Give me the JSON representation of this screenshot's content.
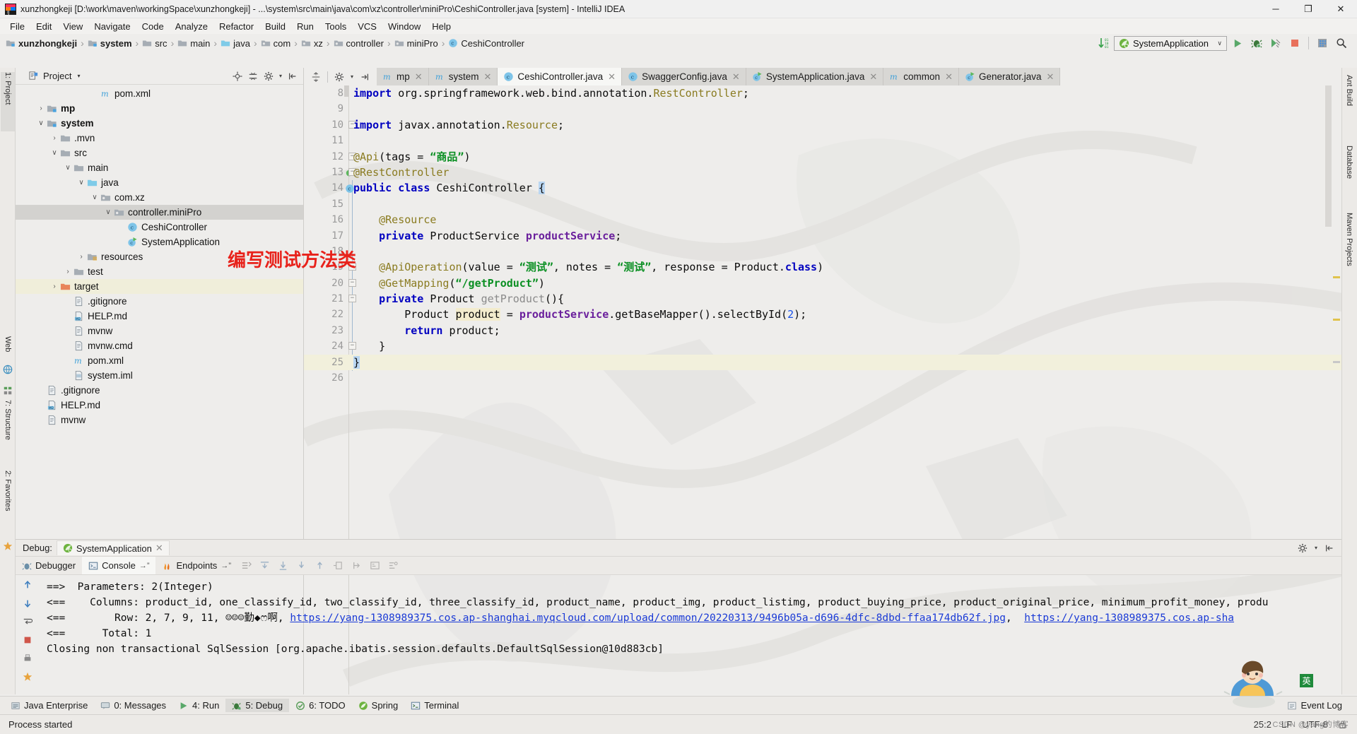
{
  "window": {
    "title": "xunzhongkeji [D:\\work\\maven\\workingSpace\\xunzhongkeji] - ...\\system\\src\\main\\java\\com\\xz\\controller\\miniPro\\CeshiController.java [system] - IntelliJ IDEA",
    "minimize": "─",
    "maximize": "❐",
    "close": "✕"
  },
  "menubar": [
    {
      "label": "File"
    },
    {
      "label": "Edit"
    },
    {
      "label": "View"
    },
    {
      "label": "Navigate"
    },
    {
      "label": "Code"
    },
    {
      "label": "Analyze"
    },
    {
      "label": "Refactor"
    },
    {
      "label": "Build"
    },
    {
      "label": "Run"
    },
    {
      "label": "Tools"
    },
    {
      "label": "VCS"
    },
    {
      "label": "Window"
    },
    {
      "label": "Help"
    }
  ],
  "breadcrumb": [
    {
      "label": "xunzhongkeji",
      "icon": "module-icon",
      "bold": true
    },
    {
      "label": "system",
      "icon": "module-icon",
      "bold": true
    },
    {
      "label": "src",
      "icon": "folder-icon",
      "bold": false
    },
    {
      "label": "main",
      "icon": "folder-icon",
      "bold": false
    },
    {
      "label": "java",
      "icon": "source-folder-icon",
      "bold": false
    },
    {
      "label": "com",
      "icon": "package-icon",
      "bold": false
    },
    {
      "label": "xz",
      "icon": "package-icon",
      "bold": false
    },
    {
      "label": "controller",
      "icon": "package-icon",
      "bold": false
    },
    {
      "label": "miniPro",
      "icon": "package-icon",
      "bold": false
    },
    {
      "label": "CeshiController",
      "icon": "class-icon",
      "bold": false
    }
  ],
  "run_config": {
    "name": "SystemApplication",
    "caret": "∨",
    "buttons": [
      "run-button",
      "debug-button",
      "run-coverage-button",
      "stop-button",
      "build-button",
      "search-everywhere-button"
    ]
  },
  "project_panel": {
    "title": "Project",
    "caret": "▾",
    "tree": [
      {
        "label": "pom.xml",
        "indent": 5,
        "arrow": "",
        "icon": "maven-icon",
        "bold": false,
        "state": ""
      },
      {
        "label": "mp",
        "indent": 1,
        "arrow": "›",
        "icon": "module-icon",
        "bold": true,
        "state": ""
      },
      {
        "label": "system",
        "indent": 1,
        "arrow": "∨",
        "icon": "module-icon",
        "bold": true,
        "state": ""
      },
      {
        "label": ".mvn",
        "indent": 2,
        "arrow": "›",
        "icon": "folder-icon",
        "bold": false,
        "state": ""
      },
      {
        "label": "src",
        "indent": 2,
        "arrow": "∨",
        "icon": "folder-icon",
        "bold": false,
        "state": ""
      },
      {
        "label": "main",
        "indent": 3,
        "arrow": "∨",
        "icon": "folder-icon",
        "bold": false,
        "state": ""
      },
      {
        "label": "java",
        "indent": 4,
        "arrow": "∨",
        "icon": "source-folder-icon",
        "bold": false,
        "state": ""
      },
      {
        "label": "com.xz",
        "indent": 5,
        "arrow": "∨",
        "icon": "package-icon",
        "bold": false,
        "state": ""
      },
      {
        "label": "controller.miniPro",
        "indent": 6,
        "arrow": "∨",
        "icon": "package-icon",
        "bold": false,
        "state": "sel"
      },
      {
        "label": "CeshiController",
        "indent": 7,
        "arrow": "",
        "icon": "class-icon",
        "bold": false,
        "state": ""
      },
      {
        "label": "SystemApplication",
        "indent": 7,
        "arrow": "",
        "icon": "spring-class-icon",
        "bold": false,
        "state": ""
      },
      {
        "label": "resources",
        "indent": 4,
        "arrow": "›",
        "icon": "resources-folder-icon",
        "bold": false,
        "state": ""
      },
      {
        "label": "test",
        "indent": 3,
        "arrow": "›",
        "icon": "folder-icon",
        "bold": false,
        "state": ""
      },
      {
        "label": "target",
        "indent": 2,
        "arrow": "›",
        "icon": "target-folder-icon",
        "bold": false,
        "state": "tgt"
      },
      {
        "label": ".gitignore",
        "indent": 3,
        "arrow": "",
        "icon": "file-icon",
        "bold": false,
        "state": ""
      },
      {
        "label": "HELP.md",
        "indent": 3,
        "arrow": "",
        "icon": "markdown-icon",
        "bold": false,
        "state": ""
      },
      {
        "label": "mvnw",
        "indent": 3,
        "arrow": "",
        "icon": "file-icon",
        "bold": false,
        "state": ""
      },
      {
        "label": "mvnw.cmd",
        "indent": 3,
        "arrow": "",
        "icon": "file-icon",
        "bold": false,
        "state": ""
      },
      {
        "label": "pom.xml",
        "indent": 3,
        "arrow": "",
        "icon": "maven-icon",
        "bold": false,
        "state": ""
      },
      {
        "label": "system.iml",
        "indent": 3,
        "arrow": "",
        "icon": "iml-icon",
        "bold": false,
        "state": ""
      },
      {
        "label": ".gitignore",
        "indent": 1,
        "arrow": "",
        "icon": "file-icon",
        "bold": false,
        "state": ""
      },
      {
        "label": "HELP.md",
        "indent": 1,
        "arrow": "",
        "icon": "markdown-icon",
        "bold": false,
        "state": ""
      },
      {
        "label": "mvnw",
        "indent": 1,
        "arrow": "",
        "icon": "file-icon",
        "bold": false,
        "state": ""
      }
    ]
  },
  "annotation": {
    "text": "编写测试方法类",
    "color": "#e8221b"
  },
  "left_strip": [
    {
      "label": "1: Project",
      "selected": true
    },
    {
      "label": "7: Structure",
      "selected": false
    },
    {
      "label": "2: Favorites",
      "selected": false
    },
    {
      "label": "Web",
      "selected": false
    }
  ],
  "right_strip": [
    {
      "label": "Ant Build"
    },
    {
      "label": "Database"
    },
    {
      "label": "Maven Projects"
    }
  ],
  "editor_tabs": [
    {
      "label": "mp",
      "icon": "maven-icon",
      "active": false,
      "closable": true
    },
    {
      "label": "system",
      "icon": "maven-icon",
      "active": false,
      "closable": true
    },
    {
      "label": "CeshiController.java",
      "icon": "class-icon",
      "active": true,
      "closable": true
    },
    {
      "label": "SwaggerConfig.java",
      "icon": "class-icon",
      "active": false,
      "closable": true
    },
    {
      "label": "SystemApplication.java",
      "icon": "spring-class-icon",
      "active": false,
      "closable": true
    },
    {
      "label": "common",
      "icon": "maven-icon",
      "active": false,
      "closable": true
    },
    {
      "label": "Generator.java",
      "icon": "spring-class-icon",
      "active": false,
      "closable": true
    }
  ],
  "code": {
    "first_line": 8,
    "lines": [
      {
        "n": 8,
        "html": "<span class=\"kw\">import</span> org.springframework.web.bind.annotation.<span class=\"ann\">RestController</span>;"
      },
      {
        "n": 9,
        "html": ""
      },
      {
        "n": 10,
        "html": "<span class=\"kw\">import</span> javax.annotation.<span class=\"ann\">Resource</span>;",
        "fold": true
      },
      {
        "n": 11,
        "html": ""
      },
      {
        "n": 12,
        "html": "<span class=\"ann\">@Api</span>(tags = <span class=\"str\">“商品”</span>)",
        "fold": true
      },
      {
        "n": 13,
        "html": "<span class=\"ann\">@RestController</span>",
        "fold": true,
        "gutter_icon": "spring-bean-icon"
      },
      {
        "n": 14,
        "html": "<span class=\"kw\">public class</span> CeshiController <span class=\"caretbox\">{</span>",
        "gutter_icon": "class-icon"
      },
      {
        "n": 15,
        "html": ""
      },
      {
        "n": 16,
        "html": "    <span class=\"ann\">@Resource</span>"
      },
      {
        "n": 17,
        "html": "    <span class=\"kw\">private</span> ProductService <span class=\"fld\">productService</span>;"
      },
      {
        "n": 18,
        "html": ""
      },
      {
        "n": 19,
        "html": "    <span class=\"ann\">@ApiOperation</span>(value = <span class=\"str\">“测试”</span>, notes = <span class=\"str\">“测试”</span>, response = Product.<span class=\"kw\">class</span>)",
        "fold": true
      },
      {
        "n": 20,
        "html": "    <span class=\"ann\">@GetMapping</span>(<span class=\"str\">“/getProduct”</span>)",
        "fold": true
      },
      {
        "n": 21,
        "html": "    <span class=\"kw\">private</span> Product <span class=\"mth\">getProduct</span>(){",
        "fold": true
      },
      {
        "n": 22,
        "html": "        Product <span class=\"hlbox\">product</span> = <span class=\"fld\">productService</span>.getBaseMapper().selectById(<span class=\"num\">2</span>);"
      },
      {
        "n": 23,
        "html": "        <span class=\"kw\">return</span> product;"
      },
      {
        "n": 24,
        "html": "    }",
        "fold": true
      },
      {
        "n": 25,
        "html": "<span class=\"caretbox\">}</span>",
        "highlight": true
      },
      {
        "n": 26,
        "html": ""
      }
    ]
  },
  "debug": {
    "label": "Debug:",
    "session": "SystemApplication",
    "session_close": "✕",
    "tabs": [
      {
        "label": "Debugger",
        "icon": "debugger-icon",
        "active": false
      },
      {
        "label": "Console",
        "icon": "console-icon",
        "active": true,
        "suffix": "→”"
      },
      {
        "label": "Endpoints",
        "icon": "endpoints-icon",
        "active": false,
        "suffix": "→”"
      }
    ],
    "settings_icon": "gear-icon",
    "hide_icon": "hide-icon",
    "console_lines": [
      {
        "text": "==>  Parameters: 2(Integer)",
        "indent": 0
      },
      {
        "text": "<==    Columns: product_id, one_classify_id, two_classify_id, three_classify_id, product_name, product_img, product_listimg, product_buying_price, product_original_price, minimum_profit_money, produ",
        "indent": 0
      },
      {
        "text": "<==        Row: 2, 7, 9, 11, ☺☺☺勤◆ෆ啊, ",
        "indent": 0,
        "links": [
          "https://yang-1308989375.cos.ap-shanghai.myqcloud.com/upload/common/20220313/9496b05a-d696-4dfc-8dbd-ffaa174db62f.jpg",
          "https://yang-1308989375.cos.ap-sha"
        ],
        "between": ",  "
      },
      {
        "text": "<==      Total: 1",
        "indent": 0
      },
      {
        "text": "Closing non transactional SqlSession [org.apache.ibatis.session.defaults.DefaultSqlSession@10d883cb]",
        "indent": 0
      }
    ]
  },
  "tool_window_bar": [
    {
      "label": "Java Enterprise",
      "icon": "java-ee-icon",
      "active": false,
      "underline": ""
    },
    {
      "label": "0: Messages",
      "icon": "messages-icon",
      "active": false,
      "underline": "0"
    },
    {
      "label": "4: Run",
      "icon": "run-icon",
      "active": false,
      "underline": "4"
    },
    {
      "label": "5: Debug",
      "icon": "debug-icon",
      "active": true,
      "underline": "5"
    },
    {
      "label": "6: TODO",
      "icon": "todo-icon",
      "active": false,
      "underline": "6"
    },
    {
      "label": "Spring",
      "icon": "spring-icon",
      "active": false,
      "underline": ""
    },
    {
      "label": "Terminal",
      "icon": "terminal-icon",
      "active": false,
      "underline": ""
    }
  ],
  "tool_window_right": [
    {
      "label": "Event Log",
      "icon": "event-log-icon"
    }
  ],
  "status": {
    "message": "Process started",
    "line_col": "25:2",
    "line_sep": "LF",
    "encoding": "UTF-8"
  },
  "watermark": {
    "csdn": "CSDN @yang的博客",
    "lang_badge": "英"
  },
  "colors": {
    "accent_blue": "#3b7dd8",
    "annotation_red": "#e8221b",
    "link_blue": "#1a3ad6",
    "keyword_blue": "#0000c0",
    "string_green": "#0a8f22",
    "annotation_olive": "#8a7b20",
    "field_purple": "#6a1f9c",
    "selection_gray": "#d3d2cf",
    "target_yellow": "#f0eeda"
  }
}
